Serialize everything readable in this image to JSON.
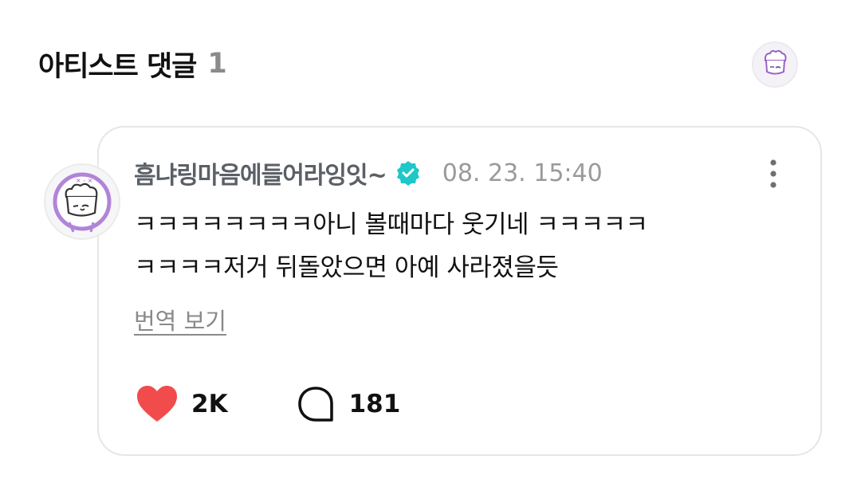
{
  "header": {
    "title": "아티스트 댓글",
    "count": "1"
  },
  "comment": {
    "author": "흠냐링마음에들어라잉잇~",
    "verified_icon": "verified-badge-icon",
    "timestamp": "08. 23. 15:40",
    "text_line1": "ㅋㅋㅋㅋㅋㅋㅋㅋ아니 볼때마다 웃기네 ㅋㅋㅋㅋㅋ",
    "text_line2": "ㅋㅋㅋㅋ저거 뒤돌았으면 아예 사라졌을듯",
    "translate_label": "번역 보기",
    "likes": "2K",
    "replies": "181"
  },
  "colors": {
    "verified": "#1fc7c7",
    "heart": "#f24b4b",
    "avatar_outline": "#9a62c8"
  }
}
